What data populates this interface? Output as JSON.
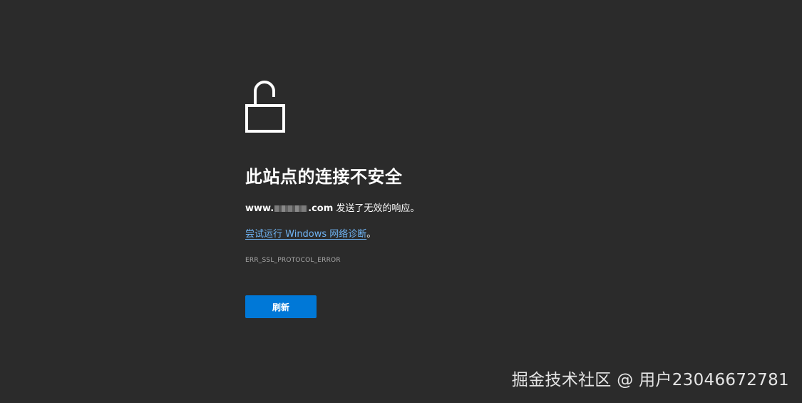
{
  "error_page": {
    "title": "此站点的连接不安全",
    "domain_prefix": "www.",
    "domain_suffix": ".com",
    "message_suffix": " 发送了无效的响应。",
    "diagnostics_link": "尝试运行 Windows 网络诊断",
    "diagnostics_end": "。",
    "error_code": "ERR_SSL_PROTOCOL_ERROR",
    "refresh_label": "刷新"
  },
  "icons": {
    "main": "unlocked-padlock-icon"
  },
  "colors": {
    "background": "#2b2b2b",
    "link": "#6fb3f3",
    "button": "#0078d7"
  },
  "watermark": {
    "text": "掘金技术社区 @ 用户23046672781"
  }
}
